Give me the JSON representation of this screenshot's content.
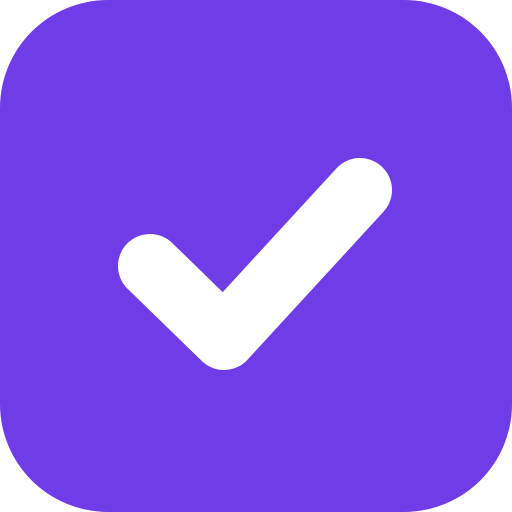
{
  "icon": {
    "name": "checkbox-checked-icon",
    "background_color": "#6f3ce8",
    "glyph_color": "#ffffff"
  }
}
